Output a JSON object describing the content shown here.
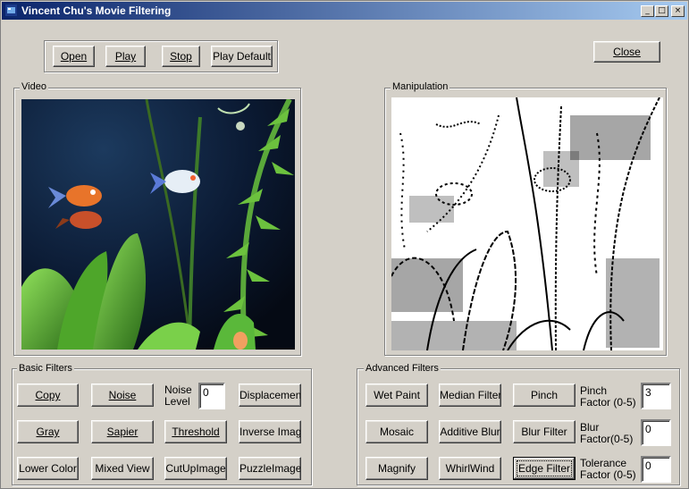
{
  "window": {
    "title": "Vincent Chu's Movie Filtering",
    "controls": {
      "minimize": "_",
      "maximize": "□",
      "close": "×"
    }
  },
  "playback": {
    "open_label": "Open",
    "play_label": "Play",
    "stop_label": "Stop",
    "play_default_label": "Play Default"
  },
  "close_label": "Close",
  "video": {
    "label": "Video"
  },
  "manipulation": {
    "label": "Manipulation"
  },
  "basic_filters": {
    "label": "Basic Filters",
    "copy": "Copy",
    "noise": "Noise",
    "noise_level_label": "Noise Level",
    "noise_level_value": "0",
    "displacement": "Displacement",
    "gray": "Gray",
    "sapier": "Sapier",
    "threshold": "Threshold",
    "inverse_image": "Inverse Image",
    "lower_color": "Lower Color",
    "mixed_view": "Mixed View",
    "cut_up_image": "CutUpImage",
    "puzzle_image": "PuzzleImage"
  },
  "advanced_filters": {
    "label": "Advanced Filters",
    "wet_paint": "Wet Paint",
    "median_filter": "Median Filter",
    "pinch": "Pinch",
    "pinch_factor_label": "Pinch Factor (0-5)",
    "pinch_factor_value": "3",
    "mosaic": "Mosaic",
    "additive_blur": "Additive Blur",
    "blur_filter": "Blur Filter",
    "blur_factor_label": "Blur Factor(0-5)",
    "blur_factor_value": "0",
    "magnify": "Magnify",
    "whirlwind": "WhirlWind",
    "edge_filter": "Edge Filter",
    "tolerance_factor_label": "Tolerance Factor (0-5)",
    "tolerance_factor_value": "0"
  },
  "icons": {
    "app": "app-icon",
    "minimize": "minimize-icon",
    "maximize": "maximize-icon",
    "close": "close-icon"
  },
  "colors": {
    "title_start": "#0a246a",
    "title_end": "#a6caf0",
    "face": "#d4d0c8",
    "aquarium": "#0b1a33",
    "plant": "#4caf2a"
  }
}
